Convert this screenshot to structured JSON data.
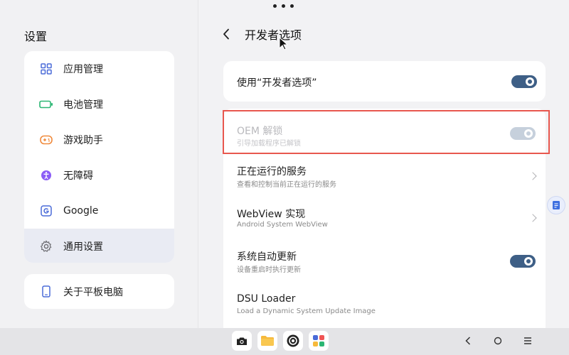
{
  "sidebar": {
    "title": "设置",
    "items": [
      {
        "label": "应用管理",
        "icon": "apps-grid-icon"
      },
      {
        "label": "电池管理",
        "icon": "battery-icon"
      },
      {
        "label": "游戏助手",
        "icon": "gamepad-icon"
      },
      {
        "label": "无障碍",
        "icon": "accessibility-icon"
      },
      {
        "label": "Google",
        "icon": "google-icon"
      },
      {
        "label": "通用设置",
        "icon": "gear-icon",
        "active": true
      }
    ],
    "about": {
      "label": "关于平板电脑",
      "icon": "tablet-icon"
    }
  },
  "header": {
    "title": "开发者选项"
  },
  "options": {
    "use_dev": {
      "title": "使用“开发者选项”",
      "enabled": true
    },
    "oem_unlock": {
      "title": "OEM 解锁",
      "subtitle": "引导加载程序已解锁",
      "enabled": true,
      "disabled": true
    },
    "running_services": {
      "title": "正在运行的服务",
      "subtitle": "查看和控制当前正在运行的服务"
    },
    "webview": {
      "title": "WebView 实现",
      "subtitle": "Android System WebView"
    },
    "auto_update": {
      "title": "系统自动更新",
      "subtitle": "设备重启时执行更新",
      "enabled": true
    },
    "dsu_loader": {
      "title": "DSU Loader",
      "subtitle": "Load a Dynamic System Update Image"
    }
  },
  "colors": {
    "accent": "#3e5f86",
    "highlight": "#e8574e",
    "active_bg": "#e9ebf3"
  },
  "dock": [
    "camera-icon",
    "folder-icon",
    "settings-app-icon",
    "app-drawer-icon"
  ],
  "navigation": [
    "back-nav-icon",
    "home-nav-icon",
    "menu-nav-icon"
  ]
}
